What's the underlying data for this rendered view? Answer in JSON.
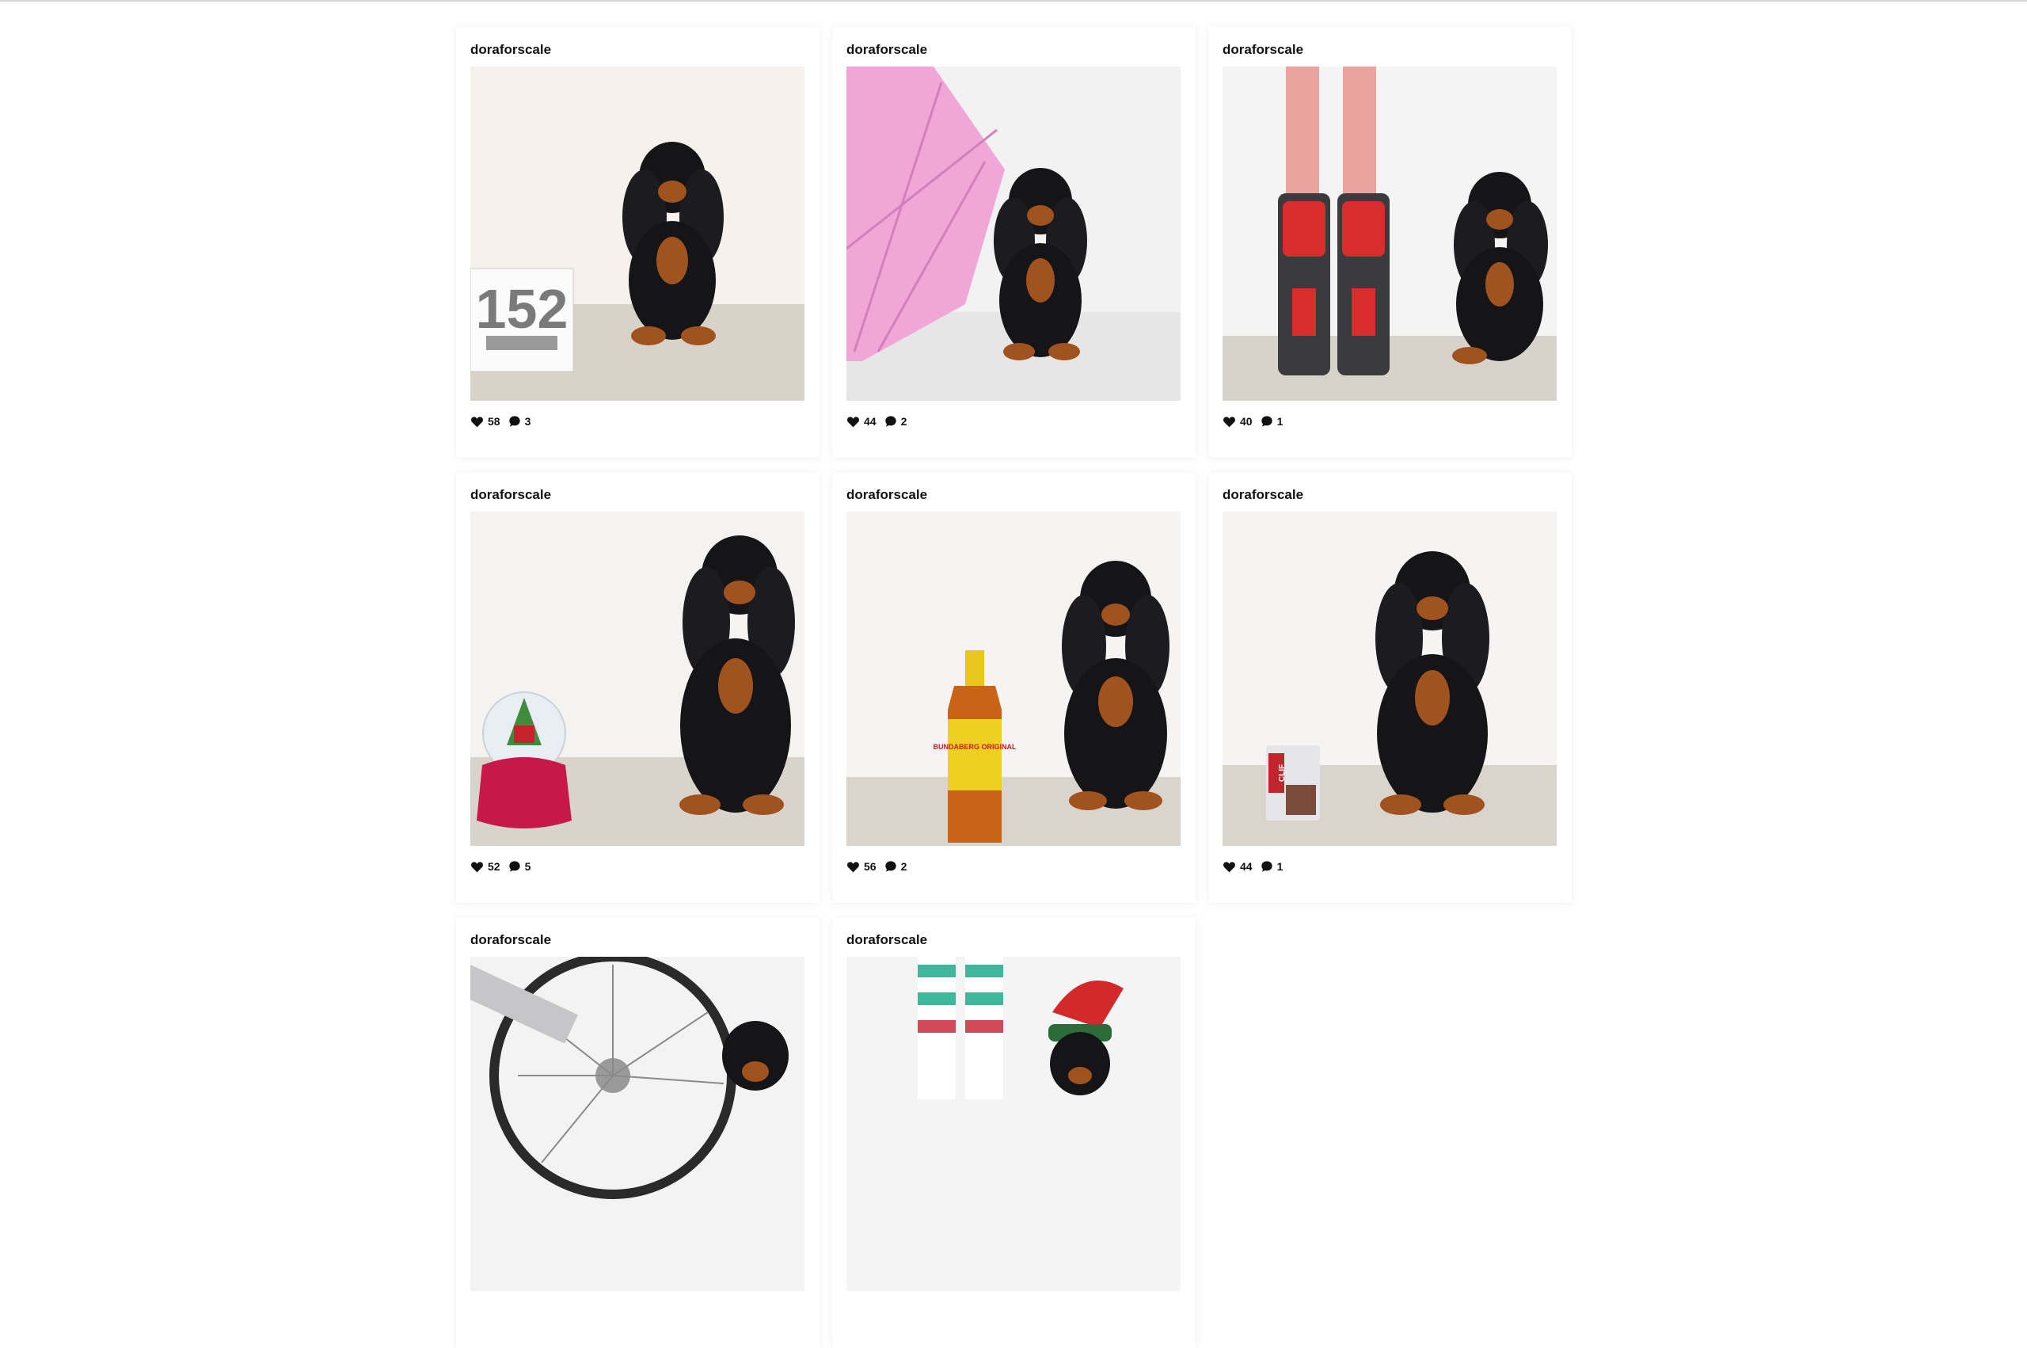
{
  "feed": {
    "posts": [
      {
        "username": "doraforscale",
        "likes": "58",
        "comments": "3",
        "prop": "race-number-card",
        "prop_text": "152",
        "bg": "#f6f1ea",
        "floor": "#d9d2c7"
      },
      {
        "username": "doraforscale",
        "likes": "44",
        "comments": "2",
        "prop": "pink-umbrella",
        "bg": "#f2f2f2",
        "floor": "#e6e6e6"
      },
      {
        "username": "doraforscale",
        "likes": "40",
        "comments": "1",
        "prop": "motorcycle-boots",
        "bg": "#f4f4f4",
        "floor": "#d7d2ca"
      },
      {
        "username": "doraforscale",
        "likes": "52",
        "comments": "5",
        "prop": "snow-globe",
        "bg": "#f5f3f1",
        "floor": "#d8d3cb"
      },
      {
        "username": "doraforscale",
        "likes": "56",
        "comments": "2",
        "prop": "rum-bottle",
        "prop_text": "BUNDABERG ORIGINAL",
        "bg": "#f5f4f2",
        "floor": "#d9d4cc"
      },
      {
        "username": "doraforscale",
        "likes": "44",
        "comments": "1",
        "prop": "clif-bar",
        "prop_text": "CLIF",
        "bg": "#f5f4f2",
        "floor": "#d9d4cc"
      },
      {
        "username": "doraforscale",
        "likes": "",
        "comments": "",
        "prop": "bicycle-wheel",
        "bg": "#f3f3f3",
        "floor": "#dcd7d0"
      },
      {
        "username": "doraforscale",
        "likes": "",
        "comments": "",
        "prop": "striped-socks-elf-hat",
        "bg": "#f4f4f4",
        "floor": "#dcd7d0"
      }
    ]
  },
  "colors": {
    "dog_black": "#151518",
    "dog_tan": "#a0521f",
    "text": "#111111"
  },
  "icons": {
    "like": "heart-icon",
    "comment": "comment-bubble-icon"
  }
}
